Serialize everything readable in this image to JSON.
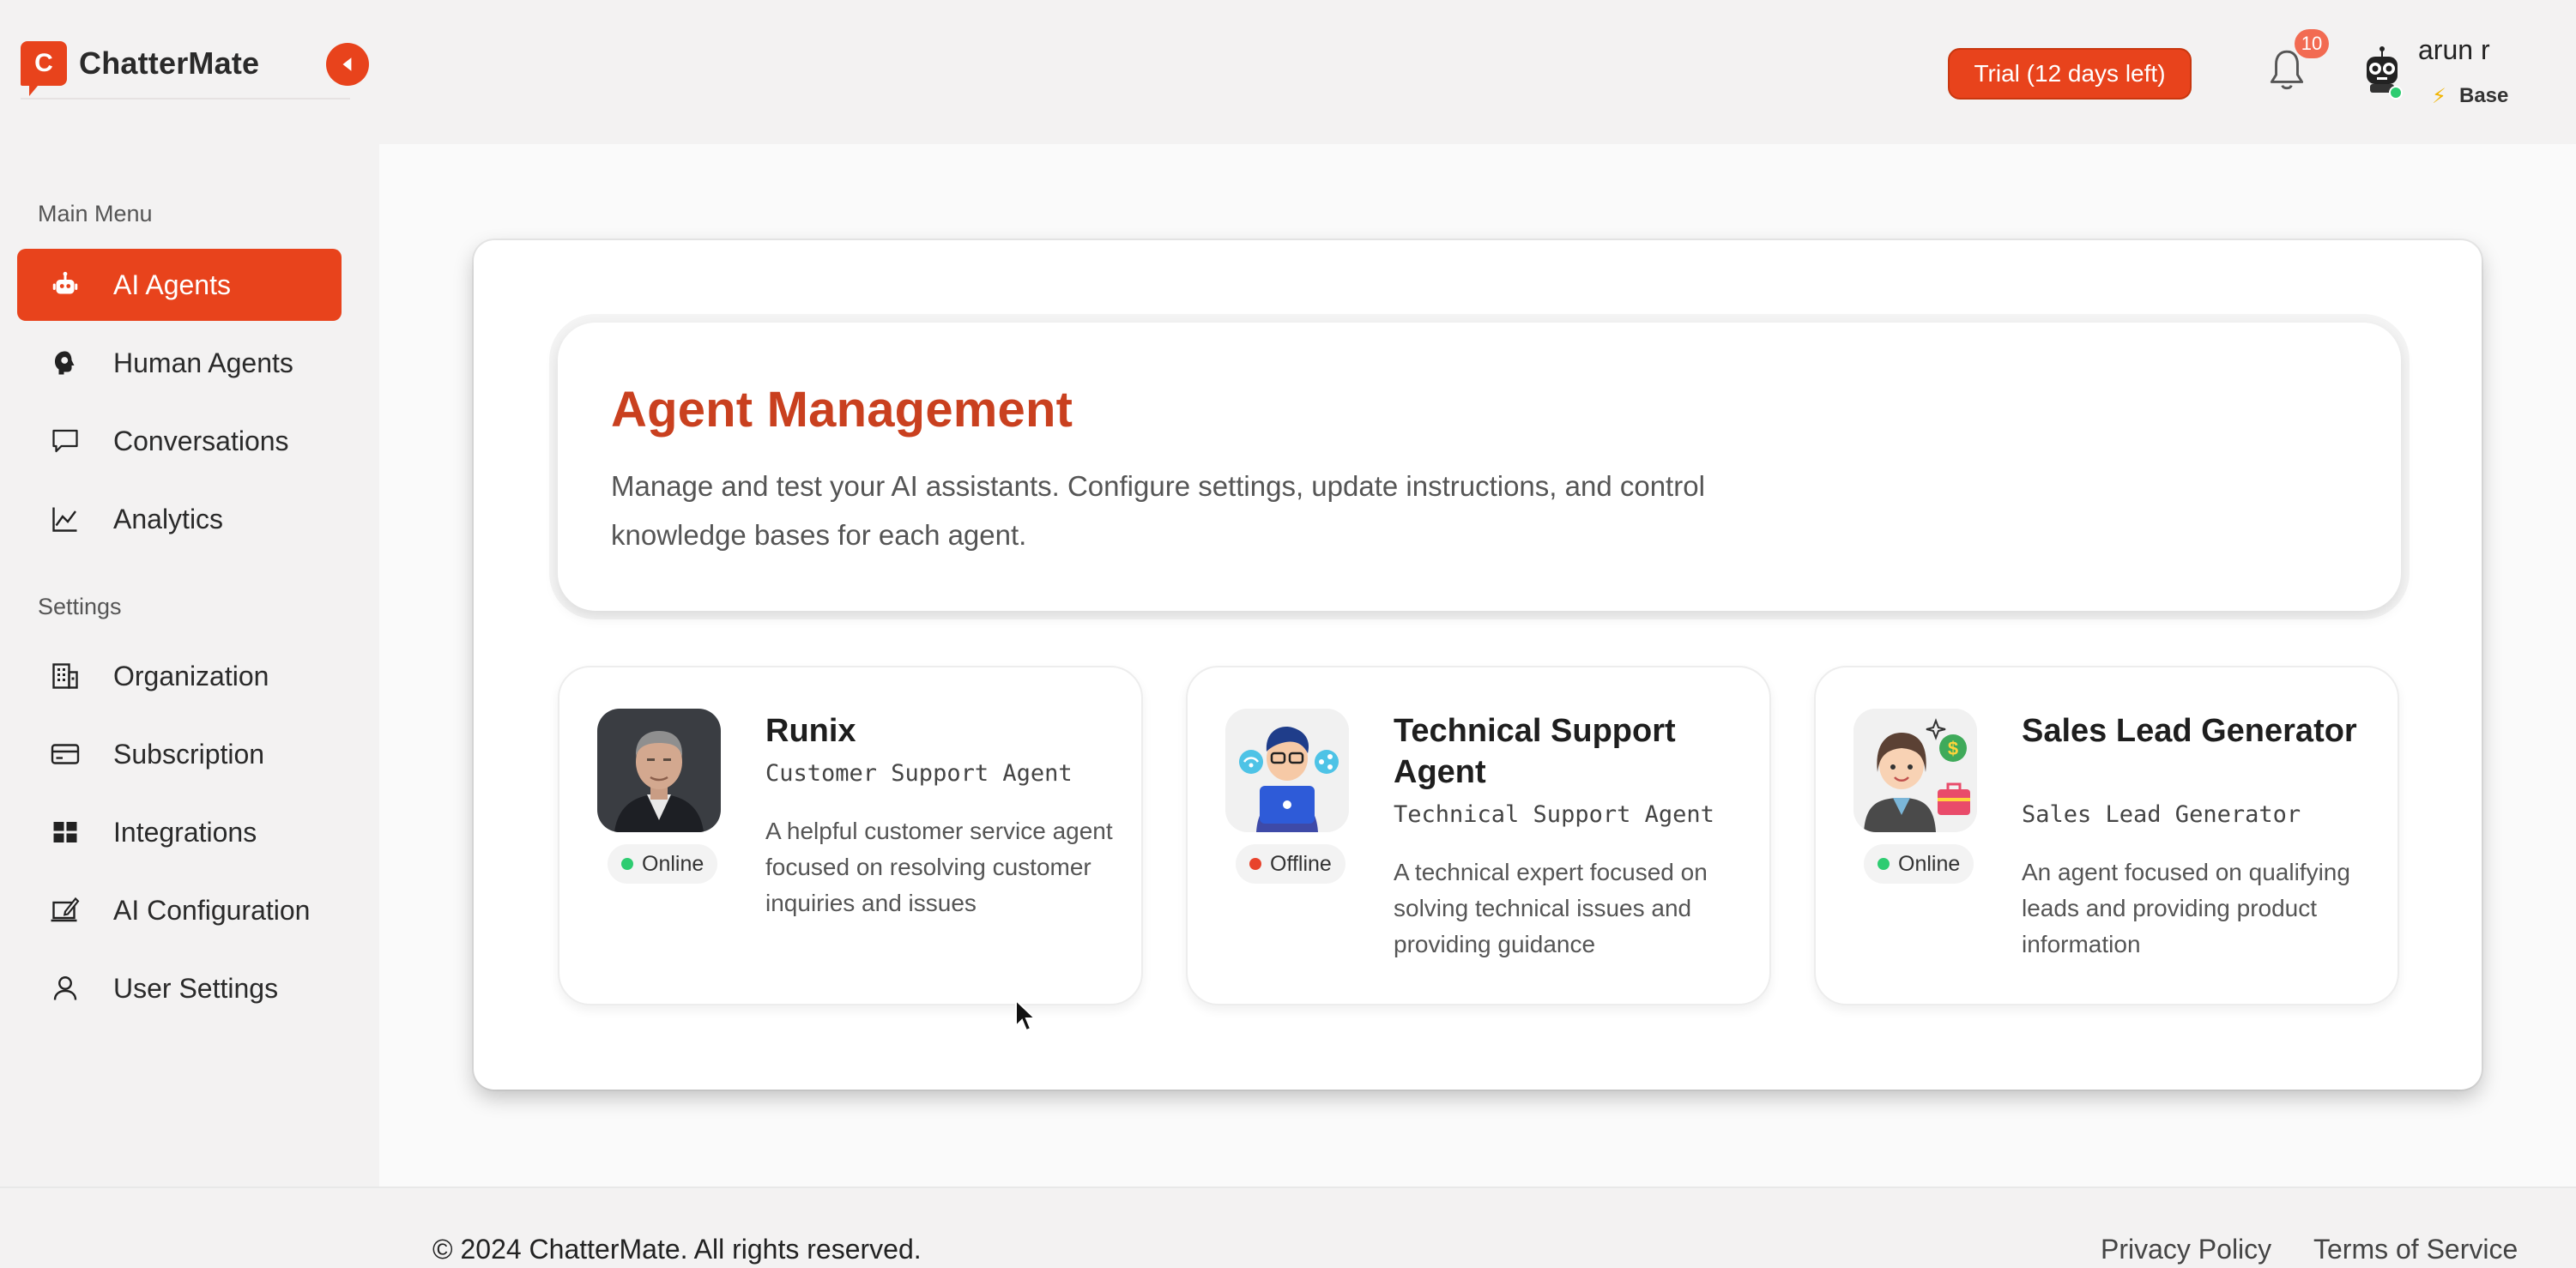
{
  "brand": {
    "logo_letter": "C",
    "name": "ChatterMate"
  },
  "header": {
    "trial_label": "Trial (12 days left)",
    "notification_count": "10",
    "user_name": "arun r",
    "plan_icon": "⚡",
    "plan": "Base"
  },
  "sidebar": {
    "main_menu_label": "Main Menu",
    "settings_label": "Settings",
    "main_items": [
      {
        "label": "AI Agents",
        "icon": "robot-icon",
        "active": true
      },
      {
        "label": "Human Agents",
        "icon": "headset-icon"
      },
      {
        "label": "Conversations",
        "icon": "chat-bubble-icon"
      },
      {
        "label": "Analytics",
        "icon": "line-chart-icon"
      }
    ],
    "settings_items": [
      {
        "label": "Organization",
        "icon": "building-icon"
      },
      {
        "label": "Subscription",
        "icon": "credit-card-icon"
      },
      {
        "label": "Integrations",
        "icon": "grid-icon"
      },
      {
        "label": "AI Configuration",
        "icon": "edit-screen-icon"
      },
      {
        "label": "User Settings",
        "icon": "user-icon"
      }
    ]
  },
  "main": {
    "title": "Agent Management",
    "description": "Manage and test your AI assistants. Configure settings, update instructions, and control knowledge bases for each agent.",
    "agents": [
      {
        "name": "Runix",
        "role": "Customer Support Agent",
        "description": "A helpful customer service agent focused on resolving customer inquiries and issues",
        "status": "Online",
        "status_color": "#2ecc71"
      },
      {
        "name": "Technical Support Agent",
        "role": "Technical Support Agent",
        "description": "A technical expert focused on solving technical issues and providing guidance",
        "status": "Offline",
        "status_color": "#e8432c"
      },
      {
        "name": "Sales Lead Generator",
        "role": "Sales Lead Generator",
        "description": "An agent focused on qualifying leads and providing product information",
        "status": "Online",
        "status_color": "#2ecc71"
      }
    ]
  },
  "footer": {
    "copyright": "© 2024 ChatterMate. All rights reserved.",
    "privacy": "Privacy Policy",
    "terms": "Terms of Service"
  },
  "colors": {
    "accent": "#e8431c",
    "title": "#c9401f",
    "online": "#2ecc71",
    "offline": "#e8432c"
  }
}
